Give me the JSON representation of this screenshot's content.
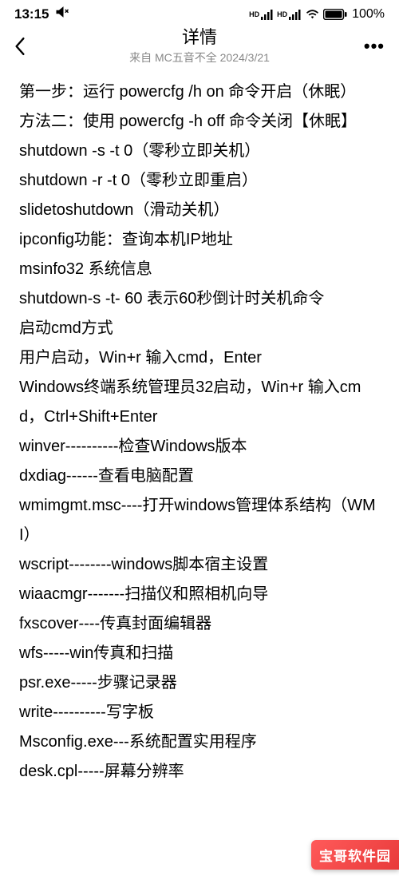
{
  "statusbar": {
    "time": "13:15",
    "battery_percent": "100%",
    "hd1": "HD",
    "hd2": "HD"
  },
  "nav": {
    "title": "详情",
    "subtitle": "来自 MC五音不全 2024/3/21"
  },
  "content": {
    "lines": [
      "第一步：运行 powercfg /h on 命令开启（休眠）",
      "方法二：使用 powercfg -h off 命令关闭【休眠】",
      "shutdown -s -t 0（零秒立即关机）",
      "shutdown -r -t 0（零秒立即重启）",
      "slidetoshutdown（滑动关机）",
      "ipconfig功能：查询本机IP地址",
      "msinfo32 系统信息",
      "shutdown-s -t- 60 表示60秒倒计时关机命令",
      "启动cmd方式",
      "用户启动，Win+r 输入cmd，Enter",
      "Windows终端系统管理员32启动，Win+r 输入cmd，Ctrl+Shift+Enter",
      "winver----------检查Windows版本",
      "dxdiag------查看电脑配置",
      "wmimgmt.msc----打开windows管理体系结构（WMI）",
      "wscript--------windows脚本宿主设置",
      "wiaacmgr-------扫描仪和照相机向导",
      "fxscover----传真封面编辑器",
      "wfs-----win传真和扫描",
      "psr.exe-----步骤记录器",
      "write----------写字板",
      "Msconfig.exe---系统配置实用程序",
      "desk.cpl-----屏幕分辨率"
    ]
  },
  "watermark": {
    "text": "宝哥软件园"
  }
}
